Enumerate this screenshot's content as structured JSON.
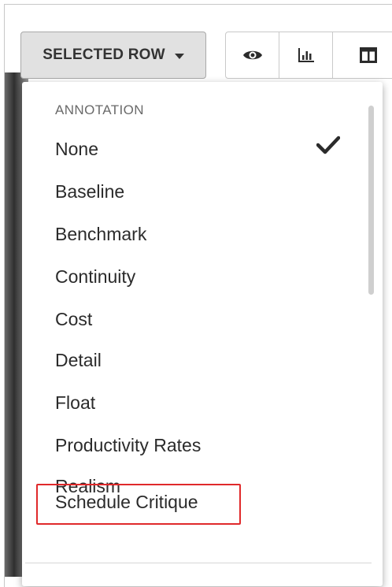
{
  "toolbar": {
    "selected_row_label": "SELECTED ROW",
    "icons": [
      "eye-icon",
      "bar-chart-icon",
      "columns-icon"
    ]
  },
  "dropdown": {
    "section_header": "ANNOTATION",
    "selected": "None",
    "items": [
      {
        "label": "None",
        "checked": true
      },
      {
        "label": "Baseline",
        "checked": false
      },
      {
        "label": "Benchmark",
        "checked": false
      },
      {
        "label": "Continuity",
        "checked": false
      },
      {
        "label": "Cost",
        "checked": false
      },
      {
        "label": "Detail",
        "checked": false
      },
      {
        "label": "Float",
        "checked": false
      },
      {
        "label": "Productivity Rates",
        "checked": false
      },
      {
        "label": "Realism",
        "checked": false
      },
      {
        "label": "Schedule Critique",
        "checked": false,
        "highlighted": true
      }
    ]
  },
  "colors": {
    "highlight_border": "#e0292b",
    "button_bg": "#e1e1e1",
    "text": "#2b2b2b"
  }
}
